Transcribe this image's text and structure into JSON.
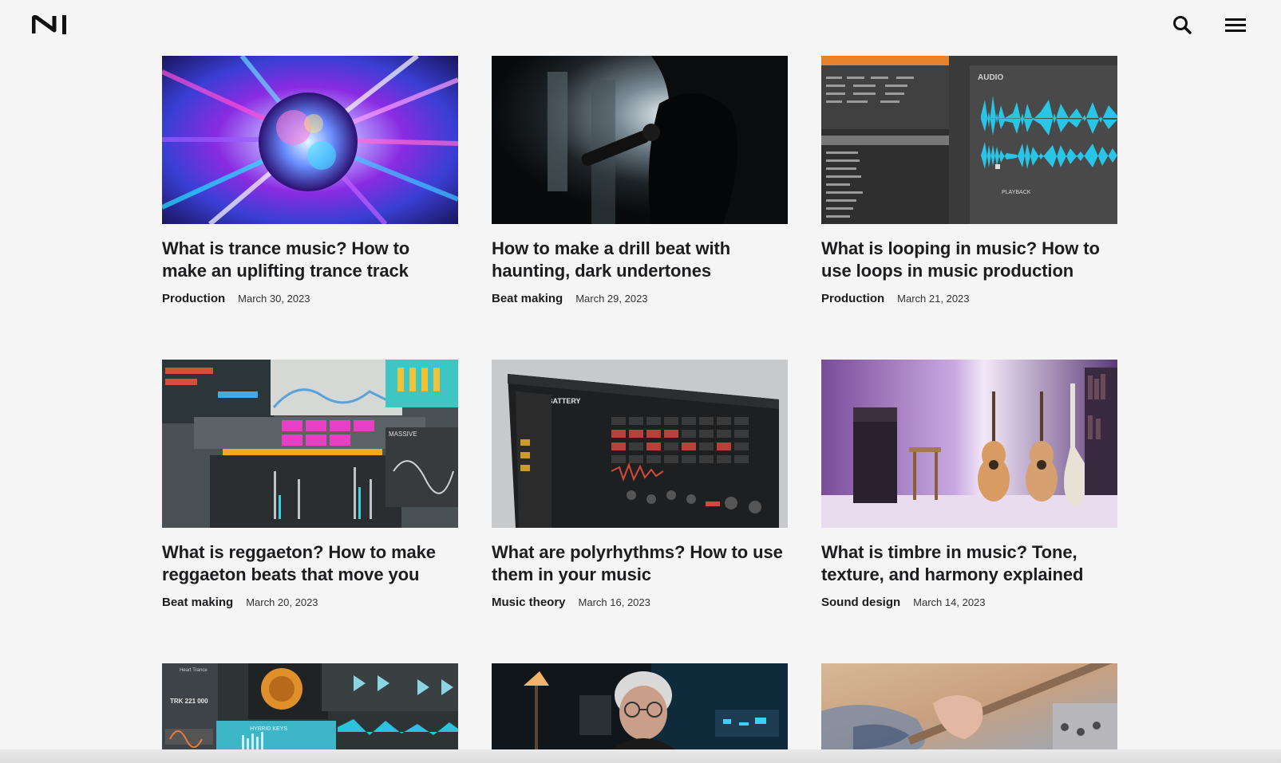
{
  "header": {
    "logo_icon": "ni-logo-icon",
    "search_icon": "search-icon",
    "menu_icon": "hamburger-menu-icon"
  },
  "articles": [
    {
      "title": "What is trance music? How to make an uplifting trance track",
      "category": "Production",
      "date": "March 30, 2023"
    },
    {
      "title": "How to make a drill beat with haunting, dark undertones",
      "category": "Beat making",
      "date": "March 29, 2023"
    },
    {
      "title": "What is looping in music? How to use loops in music production",
      "category": "Production",
      "date": "March 21, 2023"
    },
    {
      "title": "What is reggaeton? How to make reggaeton beats that move you",
      "category": "Beat making",
      "date": "March 20, 2023"
    },
    {
      "title": "What are polyrhythms? How to use them in your music",
      "category": "Music theory",
      "date": "March 16, 2023"
    },
    {
      "title": "What is timbre in music? Tone, texture, and harmony explained",
      "category": "Sound design",
      "date": "March 14, 2023"
    }
  ],
  "thumbnail_text": {
    "audio_label": "AUDIO",
    "playback_label": "PLAYBACK",
    "battery_label": "BATTERY",
    "massive_label": "MASSIVE",
    "hybrid_keys_label": "HYBRID KEYS",
    "heart_trance_label": "Heart Trance",
    "traktor_label": "TRK 221 000"
  },
  "colors": {
    "background": "#f5f5f5",
    "text": "#1d1d1f",
    "accent_cyan": "#29c5e6"
  }
}
